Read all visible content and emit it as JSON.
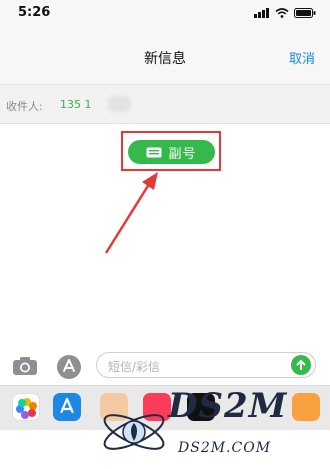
{
  "status_bar": {
    "time": "5:26"
  },
  "nav": {
    "title": "新信息",
    "cancel_label": "取消"
  },
  "recipient": {
    "label": "收件人:",
    "value": "135 1"
  },
  "line_selector": {
    "label": "副号",
    "icon": "sim-card-icon"
  },
  "input": {
    "placeholder": "短信/彩信"
  },
  "toolbar": {
    "camera_icon": "camera-icon",
    "appstore_icon": "app-store-icon",
    "send_icon": "arrow-up-icon"
  },
  "colors": {
    "accent_blue": "#1a86e8",
    "accent_green": "#35b94b",
    "highlight_red": "#e53935"
  },
  "watermark": {
    "brand": "DS2M",
    "domain": "DS2M.COM"
  }
}
